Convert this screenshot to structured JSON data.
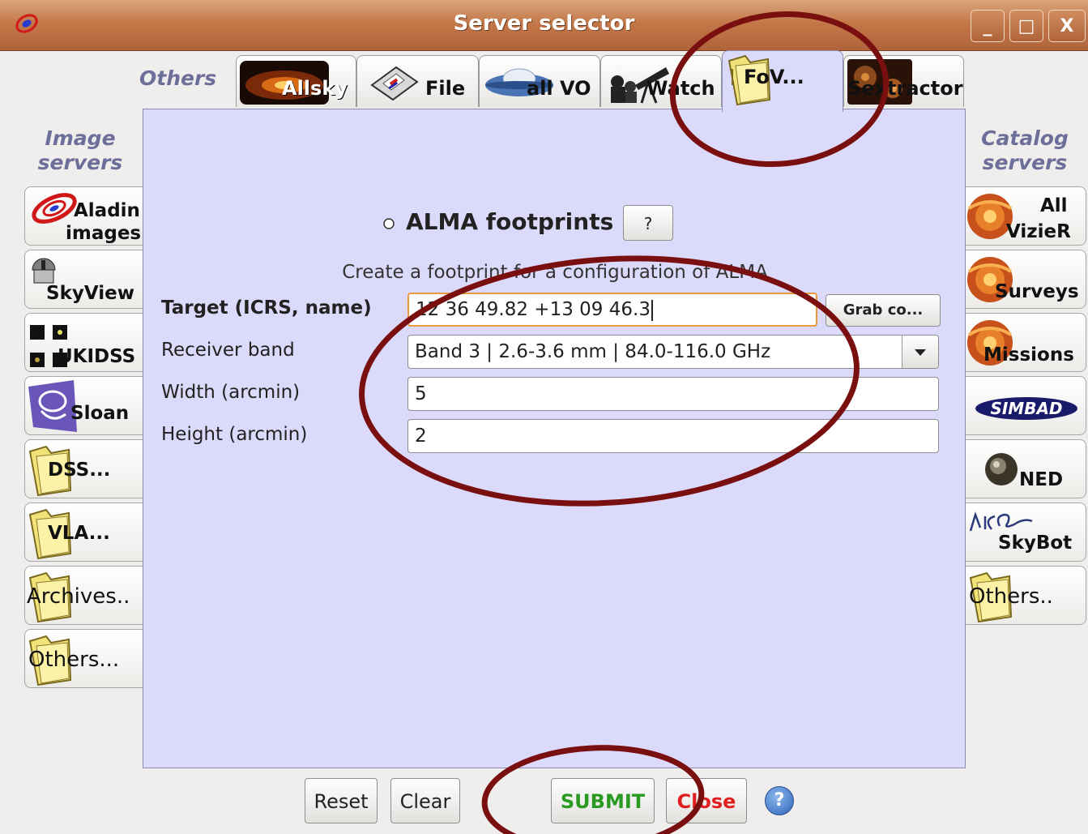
{
  "window": {
    "title": "Server selector",
    "controls": [
      "_",
      "□",
      "X"
    ],
    "title_color": "#c47849"
  },
  "top_label": "Others",
  "left_header": [
    "Image",
    "servers"
  ],
  "right_header": [
    "Catalog",
    "servers"
  ],
  "tabs": [
    {
      "label": "Allsky",
      "icon": "galaxy-icon"
    },
    {
      "label": "File",
      "icon": "disk-icon"
    },
    {
      "label": "all VO",
      "icon": "vo-icon"
    },
    {
      "label": "Watch",
      "icon": "telescope-icon"
    },
    {
      "label": "FoV...",
      "icon": "folder-icon",
      "active": true
    },
    {
      "label": "Sextractor",
      "icon": "sextractor-icon"
    }
  ],
  "left_servers": [
    {
      "label": [
        "Aladin",
        "images"
      ],
      "icon": "aladin-icon"
    },
    {
      "label": [
        "SkyView"
      ],
      "icon": "observatory-icon"
    },
    {
      "label": [
        "UKIDSS"
      ],
      "icon": "ukidss-icon"
    },
    {
      "label": [
        "Sloan"
      ],
      "icon": "sloan-icon"
    },
    {
      "label": [
        "DSS..."
      ],
      "icon": "folder-icon"
    },
    {
      "label": [
        "VLA..."
      ],
      "icon": "folder-icon"
    },
    {
      "label": [
        "Archives.."
      ],
      "icon": "folder-icon"
    },
    {
      "label": [
        "Others..."
      ],
      "icon": "folder-icon"
    }
  ],
  "right_servers": [
    {
      "label": [
        "All",
        "VizieR"
      ],
      "icon": "vizier-icon"
    },
    {
      "label": [
        "Surveys"
      ],
      "icon": "vizier-icon"
    },
    {
      "label": [
        "Missions"
      ],
      "icon": "vizier-icon"
    },
    {
      "label": [
        "SIMBAD"
      ],
      "icon": "simbad-icon"
    },
    {
      "label": [
        "NED"
      ],
      "icon": "ned-icon"
    },
    {
      "label": [
        "SkyBot"
      ],
      "icon": "skybot-icon"
    },
    {
      "label": [
        "Others.."
      ],
      "icon": "folder-icon"
    }
  ],
  "form": {
    "radio_label": "ALMA footprints",
    "help_label": "?",
    "description": "Create a footprint for a configuration of ALMA",
    "target_label": "Target (ICRS, name)",
    "target_value": "12 36 49.82 +13 09 46.3",
    "grab_label": "Grab co...",
    "band_label": "Receiver band",
    "band_value": "Band 3 | 2.6-3.6 mm | 84.0-116.0 GHz",
    "width_label": "Width (arcmin)",
    "width_value": "5",
    "height_label": "Height (arcmin)",
    "height_value": "2"
  },
  "footer": {
    "reset": "Reset",
    "clear": "Clear",
    "submit": "SUBMIT",
    "close": "Close",
    "help": "?"
  },
  "colors": {
    "panel": "#dcdafa",
    "submit": "#2a9a22",
    "close": "#e02020",
    "annotation": "#7a0f0f"
  }
}
